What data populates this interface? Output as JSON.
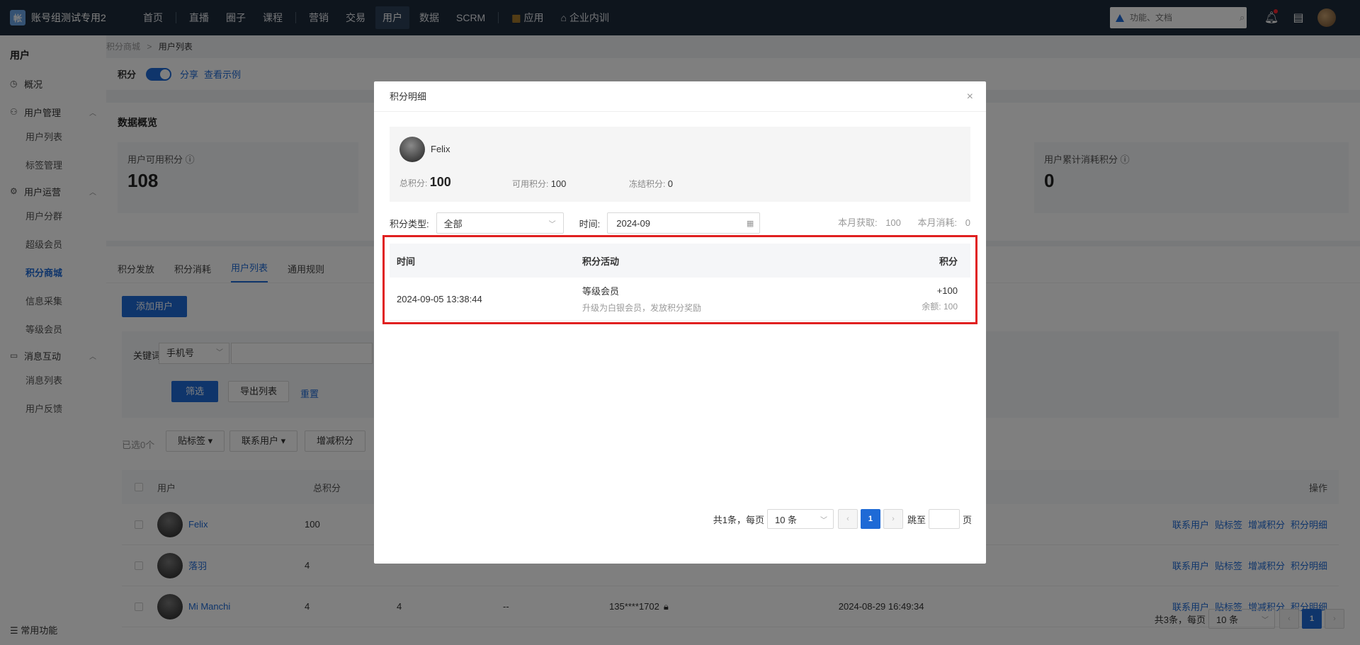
{
  "topbar": {
    "logo_text": "帐",
    "brand": "账号组测试专用2",
    "nav": [
      "首页",
      "直播",
      "圈子",
      "课程",
      "营销",
      "交易",
      "用户",
      "数据",
      "SCRM",
      "应用",
      "企业内训"
    ],
    "active_nav": "用户",
    "search_placeholder": "功能、文档"
  },
  "sidebar": {
    "title": "用户",
    "overview": "概况",
    "group_user_mgmt": "用户管理",
    "items_user_mgmt": [
      "用户列表",
      "标签管理"
    ],
    "group_user_ops": "用户运营",
    "items_user_ops": [
      "用户分群",
      "超级会员",
      "积分商城",
      "信息采集",
      "等级会员"
    ],
    "group_msg": "消息互动",
    "items_msg": [
      "消息列表",
      "用户反馈"
    ],
    "bottom": "常用功能"
  },
  "breadcrumb": {
    "parent": "积分商城",
    "sep": ">",
    "current": "用户列表"
  },
  "points_bar": {
    "label": "积分",
    "share": "分享",
    "example": "查看示例"
  },
  "overview": {
    "title": "数据概览",
    "left_label": "用户可用积分",
    "left_value": "108",
    "right_label": "用户累计消耗积分",
    "right_value": "0"
  },
  "list": {
    "tabs": [
      "积分发放",
      "积分消耗",
      "用户列表",
      "通用规则"
    ],
    "add_user": "添加用户",
    "keyword_label": "关键词:",
    "keyword_type": "手机号",
    "filter_btn": "筛选",
    "export_btn": "导出列表",
    "reset": "重置",
    "selected": "已选0个",
    "tag_btn": "贴标签 ▾",
    "contact_btn": "联系用户 ▾",
    "adjust_btn": "增减积分",
    "col_user": "用户",
    "col_total": "总积分",
    "col_ops": "操作",
    "rows": [
      {
        "name": "Felix",
        "total": "100",
        "c3": "",
        "c4": "",
        "phone": "",
        "time": ""
      },
      {
        "name": "落羽",
        "total": "4",
        "c3": "",
        "c4": "",
        "phone": "",
        "time": ""
      },
      {
        "name": "Mi Manchi",
        "total": "4",
        "c3": "4",
        "c4": "--",
        "phone": "135****1702",
        "time": "2024-08-29 16:49:34"
      }
    ],
    "ops": [
      "联系用户",
      "贴标签",
      "增减积分",
      "积分明细"
    ],
    "pager_text": "共3条，每页",
    "pager_size": "10 条",
    "pager_page": "1"
  },
  "modal": {
    "title": "积分明细",
    "close": "×",
    "user_name": "Felix",
    "total_label": "总积分:",
    "total_value": "100",
    "avail_label": "可用积分:",
    "avail_value": "100",
    "frozen_label": "冻结积分:",
    "frozen_value": "0",
    "type_label": "积分类型:",
    "type_value": "全部",
    "time_label": "时间:",
    "time_value": "2024-09",
    "month_gain_label": "本月获取:",
    "month_gain_value": "100",
    "month_spend_label": "本月消耗:",
    "month_spend_value": "0",
    "col_time": "时间",
    "col_activity": "积分活动",
    "col_points": "积分",
    "row": {
      "time": "2024-09-05 13:38:44",
      "activity": "等级会员",
      "activity_desc": "升级为白银会员，发放积分奖励",
      "points": "+100",
      "balance": "余额: 100"
    },
    "pager_total": "共1条，每页",
    "pager_size": "10 条",
    "pager_page": "1",
    "pager_jump": "跳至",
    "pager_unit": "页"
  }
}
